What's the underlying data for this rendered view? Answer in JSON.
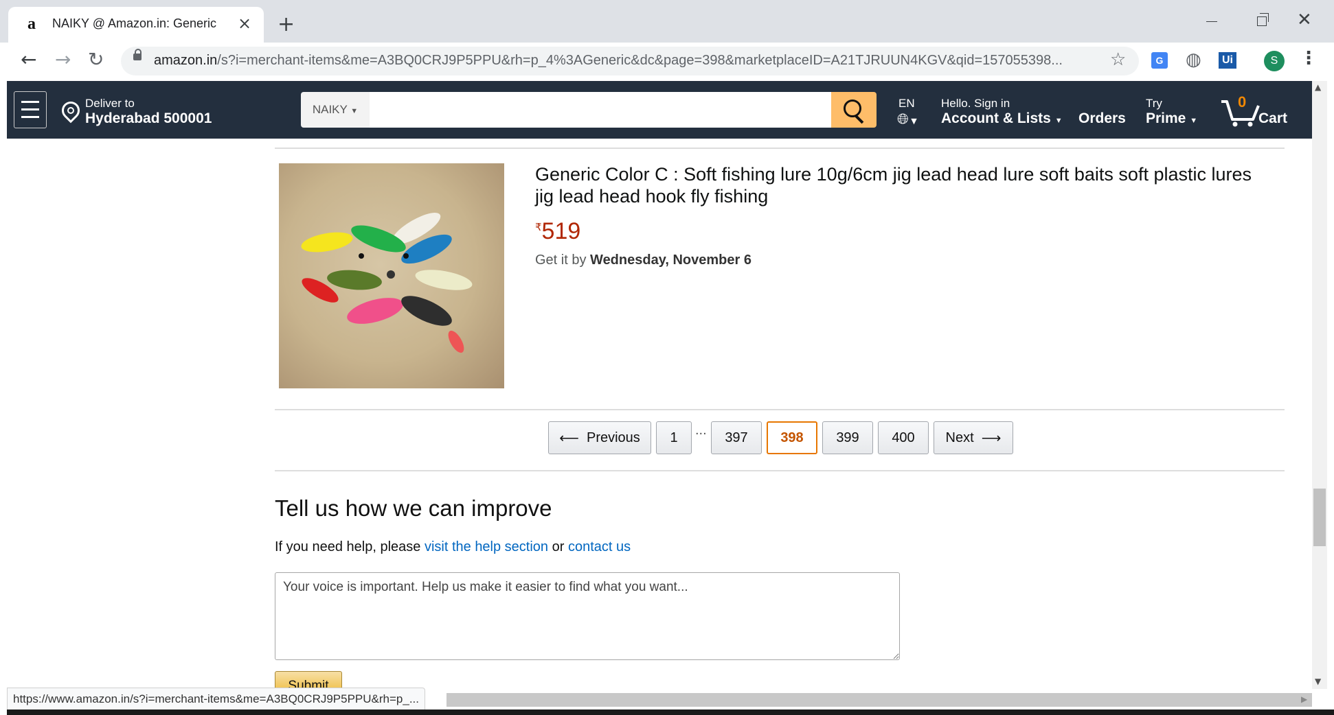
{
  "browser": {
    "tab_title": "NAIKY @ Amazon.in: Generic",
    "new_tab": "+",
    "url_domain": "amazon.in",
    "url_path": "/s?i=merchant-items&me=A3BQ0CRJ9P5PPU&rh=p_4%3AGeneric&dc&page=398&marketplaceID=A21TJRUUN4KGV&qid=157055398...",
    "profile_initial": "S",
    "status_url": "https://www.amazon.in/s?i=merchant-items&me=A3BQ0CRJ9P5PPU&rh=p_..."
  },
  "nav": {
    "deliver_line1": "Deliver to",
    "deliver_line2": "Hyderabad 500001",
    "search_category": "NAIKY",
    "search_value": "",
    "lang_code": "EN",
    "account_line1": "Hello. Sign in",
    "account_line2": "Account & Lists",
    "orders": "Orders",
    "prime_line1": "Try",
    "prime_line2": "Prime",
    "cart_count": "0",
    "cart_label": "Cart"
  },
  "product": {
    "title": "Generic Color C : Soft fishing lure 10g/6cm jig lead head lure soft baits soft plastic lures jig lead head hook fly fishing",
    "currency_symbol": "₹",
    "price": "519",
    "delivery_prefix": "Get it by",
    "delivery_date": "Wednesday, November 6"
  },
  "pagination": {
    "previous": "Previous",
    "first": "1",
    "ellipsis": "...",
    "pages": [
      "397",
      "398",
      "399",
      "400"
    ],
    "current": "398",
    "next": "Next"
  },
  "feedback": {
    "title": "Tell us how we can improve",
    "help_prefix": "If you need help, please",
    "help_link": "visit the help section",
    "help_or": "or",
    "contact_link": "contact us",
    "placeholder": "Your voice is important. Help us make it easier to find what you want...",
    "submit": "Submit"
  },
  "colors": {
    "nav_bg": "#232f3e",
    "search_button": "#febd69",
    "price": "#b12704",
    "link": "#0066c0",
    "current_page_border": "#e77600",
    "cart_count": "#f08804"
  }
}
